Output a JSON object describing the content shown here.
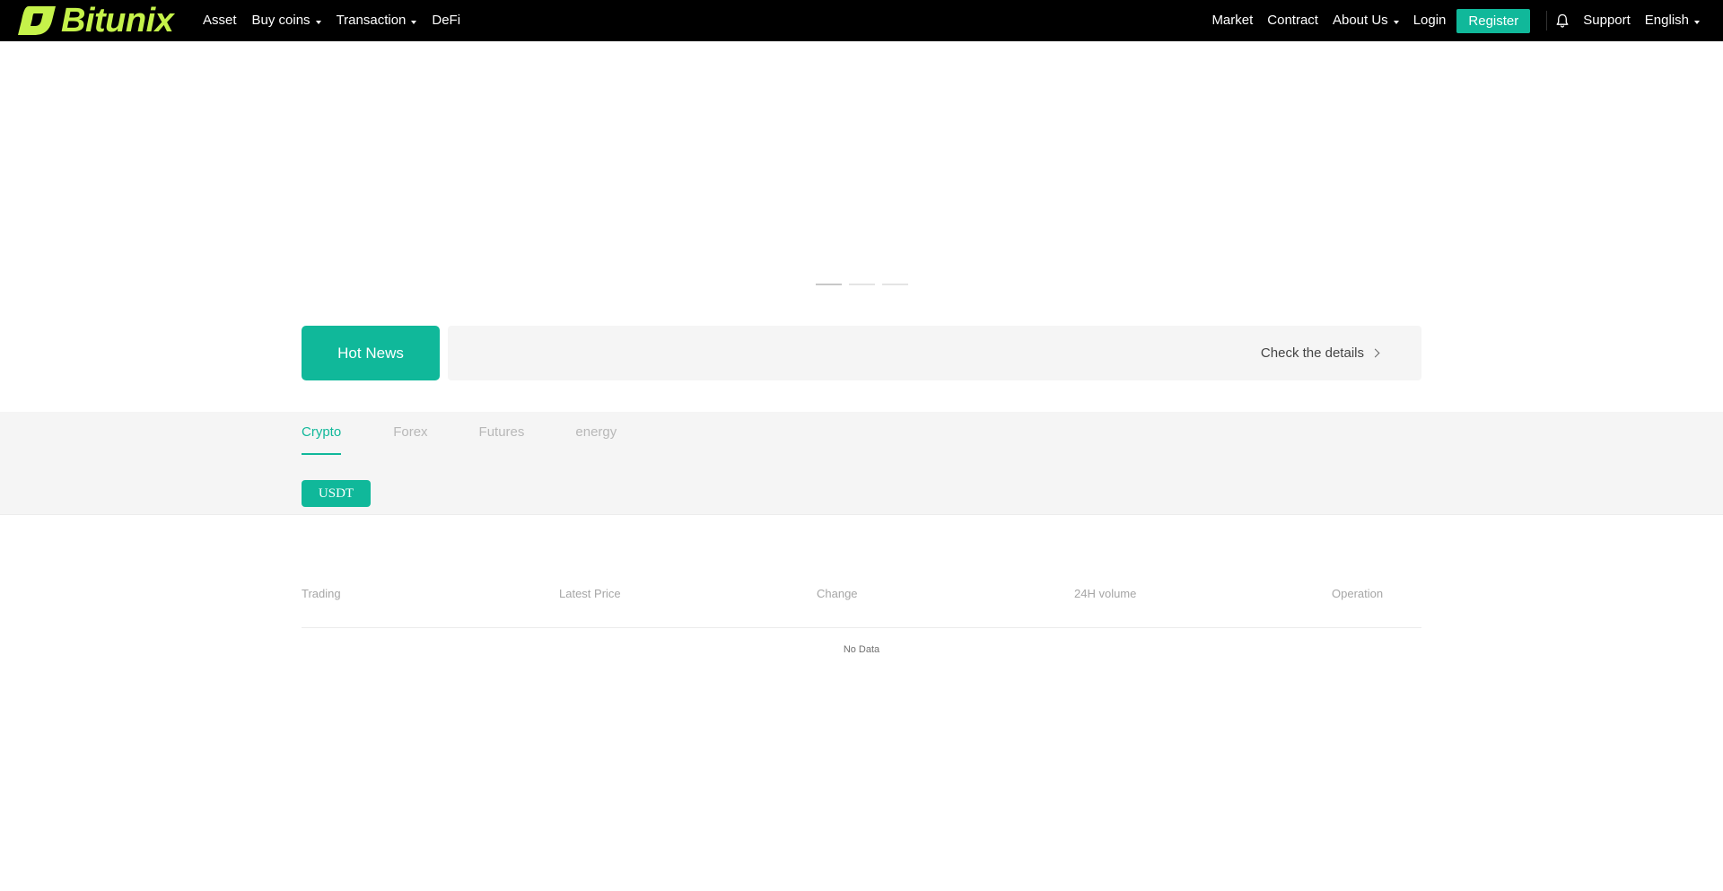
{
  "header": {
    "logo_text": "Bitunix",
    "nav_left": [
      {
        "label": "Asset",
        "dropdown": false
      },
      {
        "label": "Buy coins",
        "dropdown": true
      },
      {
        "label": "Transaction",
        "dropdown": true
      },
      {
        "label": "DeFi",
        "dropdown": false
      }
    ],
    "nav_right": {
      "market": "Market",
      "contract": "Contract",
      "about": "About Us",
      "login": "Login",
      "register": "Register",
      "support": "Support",
      "language": "English"
    },
    "icons": {
      "logo": "bitunix-logo-icon",
      "notification": "bell-icon"
    }
  },
  "banner": {
    "slides": 3,
    "active_index": 0
  },
  "hot_news": {
    "label": "Hot News",
    "ticker_text": "",
    "details_label": "Check the details"
  },
  "market": {
    "tabs": [
      {
        "label": "Crypto",
        "active": true
      },
      {
        "label": "Forex",
        "active": false
      },
      {
        "label": "Futures",
        "active": false
      },
      {
        "label": "energy",
        "active": false
      }
    ],
    "quote_currency": "USDT"
  },
  "table": {
    "columns": [
      "Trading",
      "Latest Price",
      "Change",
      "24H volume",
      "Operation"
    ],
    "empty_text": "No Data"
  },
  "colors": {
    "accent": "#10b89a",
    "logo": "#c5f24a",
    "header_bg": "#000000"
  }
}
